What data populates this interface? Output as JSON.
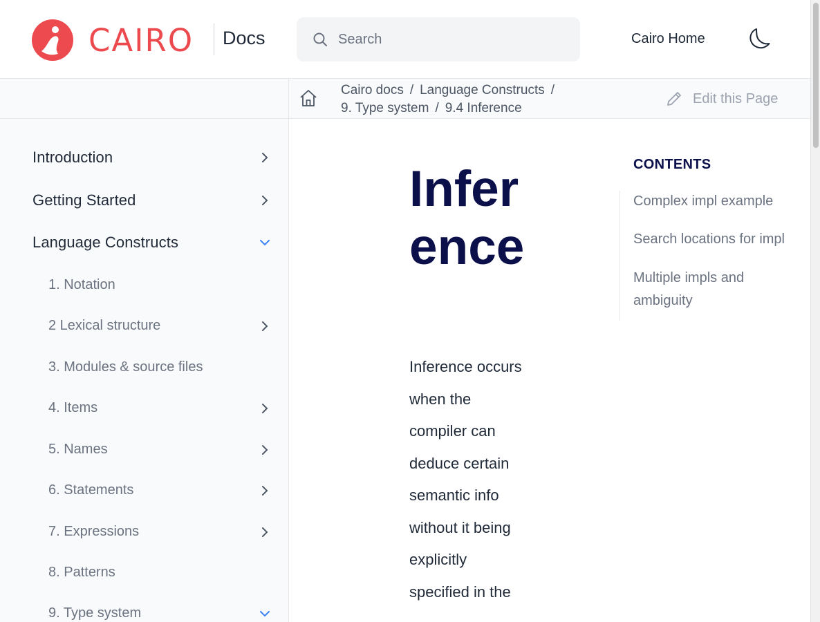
{
  "header": {
    "brand": "CAIRO",
    "docs_label": "Docs",
    "search_placeholder": "Search",
    "home_link": "Cairo Home",
    "colors": {
      "brand_red": "#ec4a4f",
      "title_navy": "#0b0f4a"
    }
  },
  "breadcrumb": {
    "items": [
      "Cairo docs",
      "Language Constructs",
      "9. Type system",
      "9.4 Inference"
    ],
    "separator": "/",
    "edit_label": "Edit this Page"
  },
  "sidebar": {
    "items": [
      {
        "label": "Introduction",
        "chevron": "right"
      },
      {
        "label": "Getting Started",
        "chevron": "right"
      },
      {
        "label": "Language Constructs",
        "chevron": "down"
      },
      {
        "label": "1. Notation",
        "chevron": ""
      },
      {
        "label": "2 Lexical structure",
        "chevron": "right"
      },
      {
        "label": "3. Modules & source files",
        "chevron": ""
      },
      {
        "label": "4. Items",
        "chevron": "right"
      },
      {
        "label": "5. Names",
        "chevron": "right"
      },
      {
        "label": "6. Statements",
        "chevron": "right"
      },
      {
        "label": "7. Expressions",
        "chevron": "right"
      },
      {
        "label": "8. Patterns",
        "chevron": ""
      },
      {
        "label": "9. Type system",
        "chevron": "down"
      }
    ]
  },
  "main": {
    "title": "Inference",
    "intro": "Inference occurs when the compiler can deduce certain semantic info without it being explicitly specified in the"
  },
  "toc": {
    "heading": "CONTENTS",
    "links": [
      "Complex impl example",
      "Search locations for impl",
      "Multiple impls and ambiguity"
    ]
  }
}
